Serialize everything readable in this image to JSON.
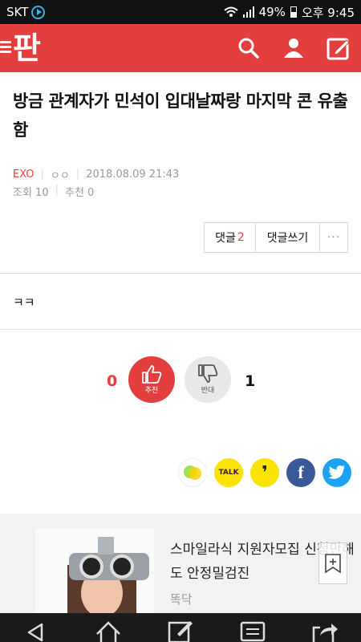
{
  "status_bar": {
    "carrier": "SKT",
    "battery": "49%",
    "time": "오후 9:45"
  },
  "app": {
    "logo": "판"
  },
  "post": {
    "title": "방금 관계자가 민석이 입대날짜랑 마지막 콘 유출함",
    "category": "EXO",
    "author": "ㅇㅇ",
    "datetime": "2018.08.09 21:43",
    "views": "조회 10",
    "recommends": "추천 0",
    "comment_label": "댓글",
    "comment_count": "2",
    "write_comment": "댓글쓰기",
    "more": "···",
    "body": "ㅋㅋ"
  },
  "vote": {
    "up_count": "0",
    "up_label": "추천",
    "down_count": "1",
    "down_label": "반대"
  },
  "share": {
    "talk_label": "TALK",
    "comma_label": "❜",
    "facebook_label": "f"
  },
  "promo": {
    "title": "스마일라식 지원자모집 신청만해도 안정밀검진",
    "source": "똑닥"
  },
  "colors": {
    "brand": "#e43f3f",
    "navbar": "#1a1a1a"
  }
}
